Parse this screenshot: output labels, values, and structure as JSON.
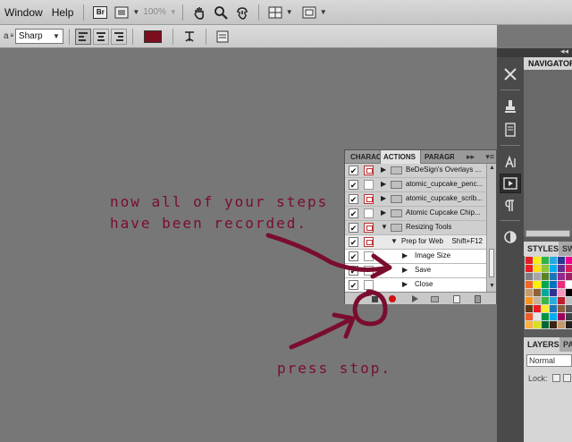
{
  "menubar": {
    "items": [
      "Window",
      "Help"
    ],
    "zoom": "100%"
  },
  "optionsbar": {
    "aa_label": "a",
    "aa_mode": "Sharp",
    "text_color": "#7a0d1e"
  },
  "navigator": {
    "title": "NAVIGATOR"
  },
  "styles_panel": {
    "tabs": [
      "STYLES",
      "SW"
    ]
  },
  "layers_panel": {
    "tabs": [
      "LAYERS",
      "PA"
    ],
    "blend_mode": "Normal",
    "lock_label": "Lock:"
  },
  "actions_panel": {
    "tabs": [
      "CHARAC",
      "ACTIONS",
      "PARAGR"
    ],
    "rows": [
      {
        "kind": "set",
        "label": "BeDeSign's Overlays ..."
      },
      {
        "kind": "set",
        "label": "atomic_cupcake_penc..."
      },
      {
        "kind": "set",
        "label": "atomic_cupcake_scrib..."
      },
      {
        "kind": "set",
        "label": "Atomic Cupcake Chip..."
      },
      {
        "kind": "set",
        "label": "Resizing Tools"
      },
      {
        "kind": "action",
        "label": "Prep for Web",
        "shortcut": "Shift+F12"
      },
      {
        "kind": "cmd",
        "label": "Image Size"
      },
      {
        "kind": "cmd",
        "label": "Save"
      },
      {
        "kind": "cmd",
        "label": "Close"
      }
    ]
  },
  "annotations": {
    "line1": "now all of your steps",
    "line2": "have been recorded.",
    "line3": "press stop.",
    "color": "#7a0d2e"
  }
}
